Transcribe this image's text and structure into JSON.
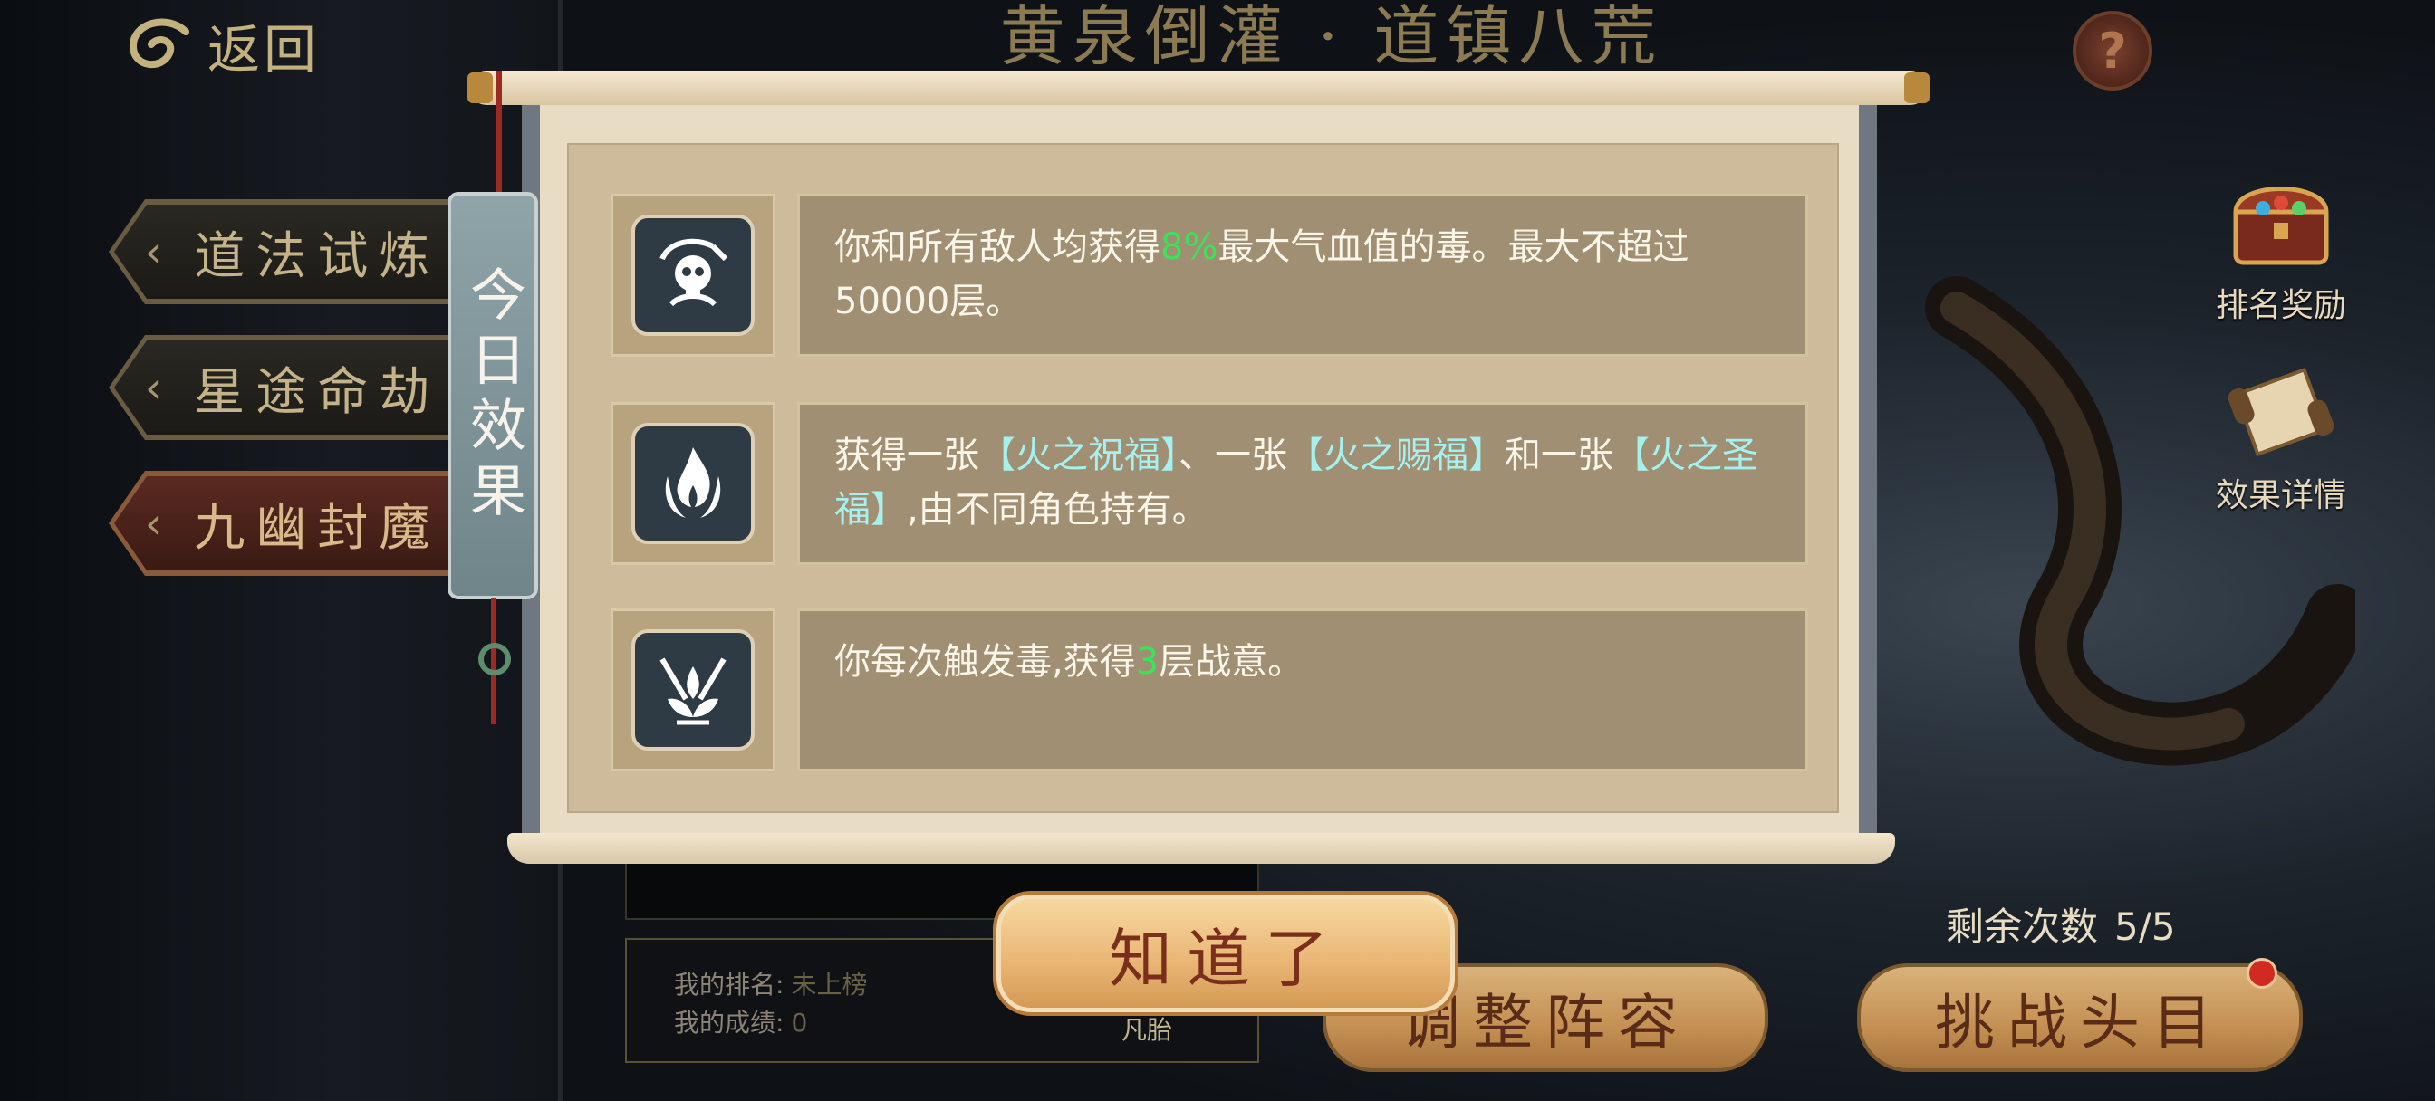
{
  "topbar": {
    "back_label": "返回",
    "title": "黄泉倒灌 · 道镇八荒",
    "help_symbol": "?"
  },
  "menu": {
    "items": [
      {
        "label": "道法试炼",
        "active": false
      },
      {
        "label": "星途命劫",
        "active": false
      },
      {
        "label": "九幽封魔",
        "active": true
      }
    ]
  },
  "side": {
    "rank_reward_label": "排名奖励",
    "effect_detail_label": "效果详情",
    "remaining_label": "剩余次数",
    "remaining_value": "5/5"
  },
  "my_info": {
    "rank_label": "我的排名:",
    "rank_value": "未上榜",
    "score_label": "我的成绩:",
    "score_value": "0",
    "tier_label": "凡胎"
  },
  "buttons": {
    "adjust": "调整阵容",
    "challenge": "挑战头目",
    "ok": "知道了"
  },
  "popup": {
    "tag": "今日效果",
    "effects": [
      {
        "icon": "skull-reaper-icon",
        "t1": "你和所有敌人均获得",
        "t2": "8%",
        "t3": "最大气血值的毒。最大不超过50000层。"
      },
      {
        "icon": "flame-icon",
        "t1": "获得一张",
        "t2": "【火之祝福】",
        "t3": "、一张",
        "t4": "【火之赐福】",
        "t5": "和一张",
        "t6": "【火之圣福】",
        "t7": ",由不同角色持有。"
      },
      {
        "icon": "lotus-swords-icon",
        "t1": "你每次触发毒,获得",
        "t2": "3",
        "t3": "层战意。"
      }
    ]
  },
  "colors": {
    "highlight_green": "#3fe05a",
    "highlight_cyan": "#a6f1f0",
    "scroll_paper": "#e9dcc4",
    "button_gold": "#c48f52"
  }
}
